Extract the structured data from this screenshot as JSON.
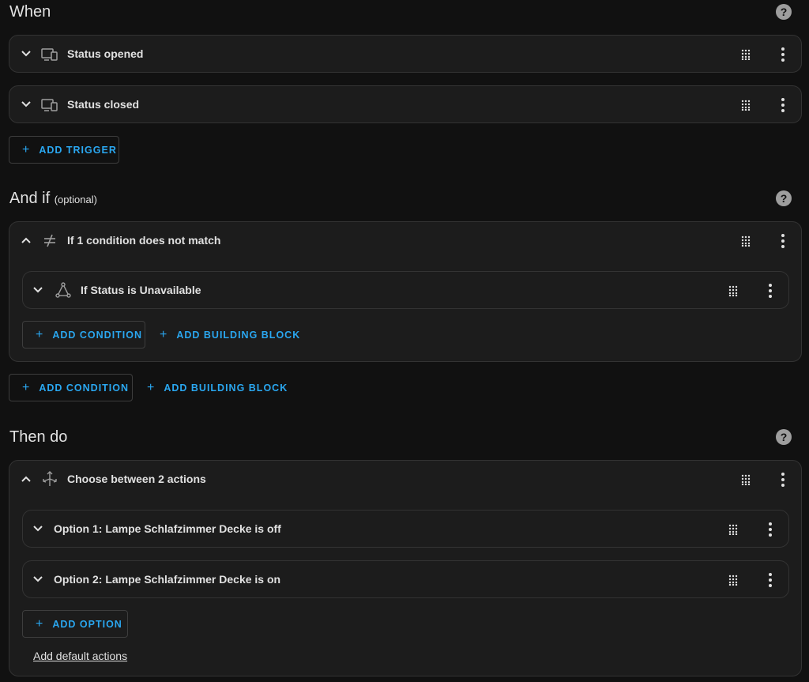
{
  "when": {
    "title": "When",
    "triggers": [
      {
        "label": "Status opened",
        "icon": "device-icon"
      },
      {
        "label": "Status closed",
        "icon": "device-icon"
      }
    ],
    "add_trigger_label": "ADD TRIGGER"
  },
  "and_if": {
    "title": "And if",
    "optional_label": "(optional)",
    "condition_group": {
      "label": "If 1 condition does not match",
      "icon": "not-equal-icon",
      "child": {
        "label": "If Status is Unavailable",
        "icon": "state-icon"
      },
      "add_condition_label": "ADD CONDITION",
      "add_building_block_label": "ADD BUILDING BLOCK"
    },
    "add_condition_label": "ADD CONDITION",
    "add_building_block_label": "ADD BUILDING BLOCK"
  },
  "then_do": {
    "title": "Then do",
    "choose": {
      "label": "Choose between 2 actions",
      "icon": "choose-arrows-icon",
      "options": [
        {
          "label": "Option 1: Lampe Schlafzimmer Decke is off"
        },
        {
          "label": "Option 2: Lampe Schlafzimmer Decke is on"
        }
      ],
      "add_option_label": "ADD OPTION",
      "add_default_label": "Add default actions"
    }
  },
  "colors": {
    "accent": "#2aa7f0",
    "background": "#111111",
    "card": "#1c1c1c",
    "border": "#333333"
  }
}
